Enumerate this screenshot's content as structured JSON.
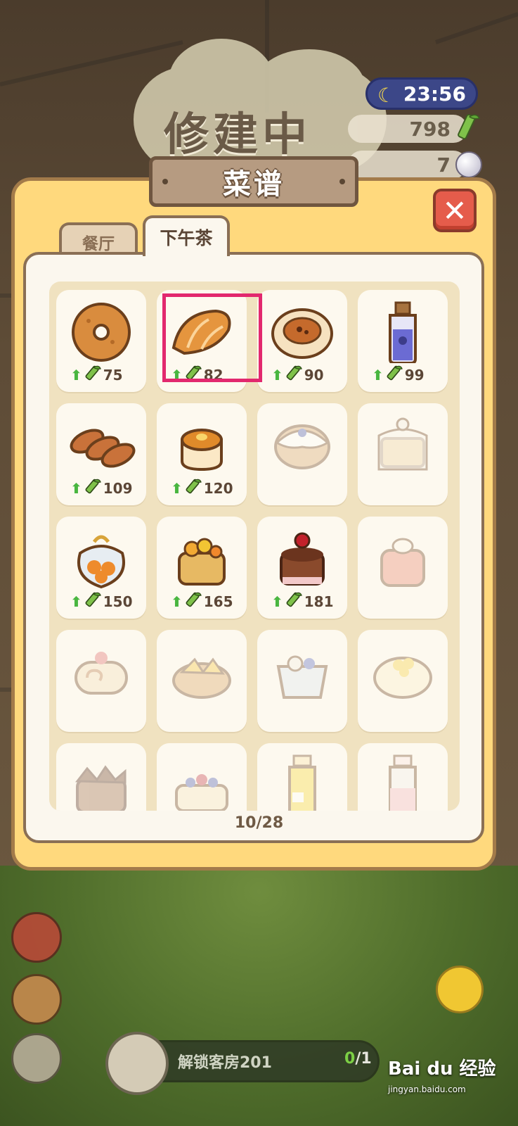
{
  "background": {
    "building_status": "修建中"
  },
  "hud": {
    "time": "23:56",
    "bamboo_count": "798",
    "pearl_count": "7"
  },
  "panel": {
    "title": "菜谱",
    "close_symbol": "✕",
    "tabs": [
      {
        "label": "餐厅",
        "active": false
      },
      {
        "label": "下午茶",
        "active": true
      }
    ],
    "page_indicator": "10/28"
  },
  "recipes": [
    {
      "icon": "donut-icon",
      "price": "75",
      "unlocked": true
    },
    {
      "icon": "croissant-icon",
      "price": "82",
      "unlocked": true,
      "highlighted": true
    },
    {
      "icon": "pizza-bread-icon",
      "price": "90",
      "unlocked": true
    },
    {
      "icon": "potion-bottle-icon",
      "price": "99",
      "unlocked": true
    },
    {
      "icon": "baguettes-icon",
      "price": "109",
      "unlocked": true
    },
    {
      "icon": "pudding-icon",
      "price": "120",
      "unlocked": true
    },
    {
      "icon": "blueberry-muffin-icon",
      "unlocked": false
    },
    {
      "icon": "bagged-cake-icon",
      "unlocked": false
    },
    {
      "icon": "candy-bag-icon",
      "price": "150",
      "unlocked": true
    },
    {
      "icon": "fruit-cake-icon",
      "price": "165",
      "unlocked": true
    },
    {
      "icon": "cherry-chocolate-cake-icon",
      "price": "181",
      "unlocked": true
    },
    {
      "icon": "cream-cake-icon",
      "unlocked": false
    },
    {
      "icon": "swiss-roll-icon",
      "unlocked": false
    },
    {
      "icon": "mango-tart-icon",
      "unlocked": false
    },
    {
      "icon": "parfait-icon",
      "unlocked": false
    },
    {
      "icon": "lemon-cake-icon",
      "unlocked": false
    },
    {
      "icon": "chocolate-cake-icon",
      "unlocked": false
    },
    {
      "icon": "berry-tart-icon",
      "unlocked": false
    },
    {
      "icon": "juice-bottle-icon",
      "unlocked": false
    },
    {
      "icon": "milk-bottle-icon",
      "unlocked": false
    }
  ],
  "quest": {
    "label": "解锁客房201",
    "progress_done": "0",
    "progress_total": "/1"
  },
  "watermark": {
    "text": "Bai du 经验",
    "url": "jingyan.baidu.com"
  },
  "colors": {
    "panel": "#ffd97d",
    "close_button": "#e55c4b",
    "highlight": "#e2286e",
    "arrow": "#49b640"
  }
}
